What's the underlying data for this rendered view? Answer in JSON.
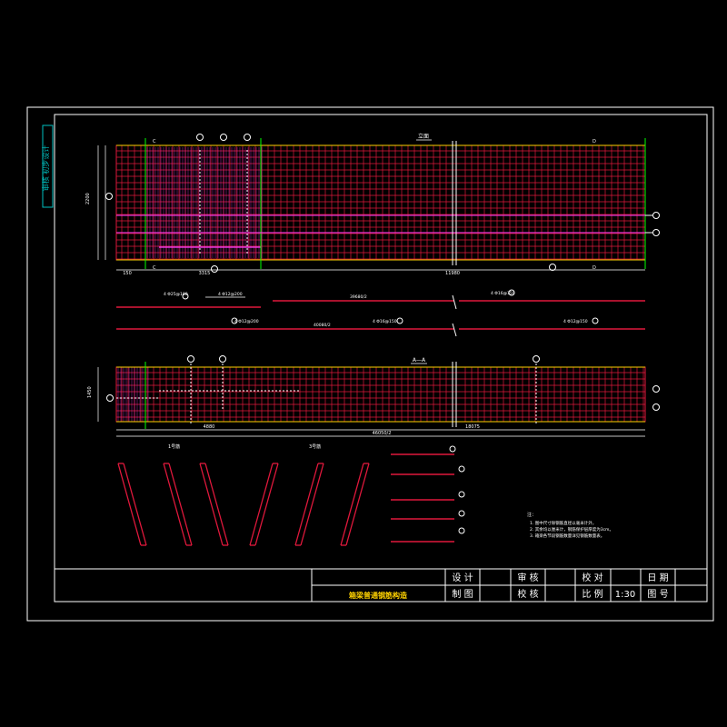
{
  "drawing": {
    "title": "箱梁普通钢筋构造",
    "section_top": "立面",
    "section_bottom": "A—A",
    "sidebar_text": "审核 初步设计",
    "cut_labels": {
      "c": "C",
      "d": "D",
      "a": "A"
    },
    "dims": {
      "top_total": "11980",
      "top_left": "3315",
      "top_mid": "3315",
      "top_small": "150",
      "bottom_total": "46050/2",
      "bottom_left": "4880",
      "bottom_right": "18075",
      "height_top": "2200",
      "height_bot": "1450"
    },
    "callouts": {
      "c3": "3",
      "c4": "4",
      "c6": "6",
      "c7": "7",
      "c8": "8",
      "c1": "1",
      "c10": "10",
      "c11": "11",
      "c12": "12",
      "c9": "9"
    },
    "rebar_notes": [
      "4 Φ25@100",
      "4 Φ12@200",
      "4 Φ16@150",
      "4 Φ12@200",
      "4 Φ16@150",
      "4 Φ12@150"
    ],
    "rebar_lengths": [
      "39680/2",
      "40080/2",
      "48600/2"
    ],
    "small_notes_top": "1号筋",
    "small_notes_mid": "3号筋",
    "notes": {
      "heading": "注：",
      "items": [
        "1. 图中尺寸除钢筋直径以毫米计外，",
        "2. 其余均以厘米计，钢筋保护层厚度为3cm。",
        "3. 箱梁各节段钢筋数量详见钢筋数量表。"
      ]
    }
  },
  "title_block": {
    "design": "设 计",
    "review": "审 核",
    "check": "校 对",
    "date": "日 期",
    "draw": "制 图",
    "proof": "校 核",
    "scale_label": "比 例",
    "scale_value": "1:30",
    "sheet_label": "图 号"
  }
}
